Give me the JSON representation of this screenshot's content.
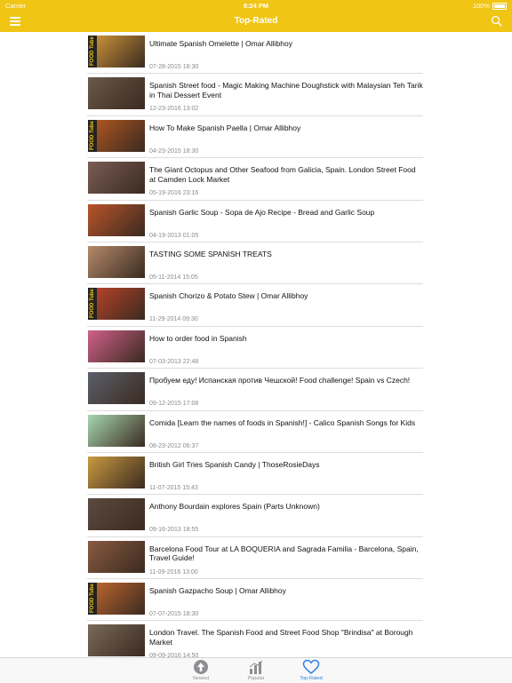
{
  "status": {
    "carrier": "Carrier",
    "time": "8:24 PM",
    "battery": "100%"
  },
  "nav": {
    "title": "Top-Rated"
  },
  "videos": [
    {
      "title": "Ultimate Spanish Omelette | Omar Allibhoy",
      "date": "07-28-2015 18:30",
      "thumb": "#d79a3a",
      "strip": "FOOD Tube"
    },
    {
      "title": "Spanish Street food - Magic Making Machine Doughstick with Malaysian Teh Tarik in Thai Dessert Event",
      "date": "12-23-2016 13:02",
      "thumb": "#6a5a4a",
      "strip": ""
    },
    {
      "title": "How To Make Spanish Paella | Omar Allibhoy",
      "date": "04-23-2015 18:30",
      "thumb": "#b85a20",
      "strip": "FOOD Tube"
    },
    {
      "title": "The Giant Octopus and Other Seafood from Galicia, Spain. London Street Food at Camden Lock Market",
      "date": "05-19-2016 23:16",
      "thumb": "#7a5d55",
      "strip": ""
    },
    {
      "title": "Spanish Garlic Soup - Sopa de Ajo Recipe - Bread and Garlic Soup",
      "date": "04-19-2013 01:05",
      "thumb": "#b9542a",
      "strip": ""
    },
    {
      "title": "TASTING SOME SPANISH TREATS",
      "date": "05-11-2014 15:05",
      "thumb": "#b48a6a",
      "strip": ""
    },
    {
      "title": "Spanish Chorizo & Potato Stew | Omar Allibhoy",
      "date": "11-29-2014 09:30",
      "thumb": "#c0452a",
      "strip": "FOOD Tube"
    },
    {
      "title": "How to order food in Spanish",
      "date": "07-03-2013 22:48",
      "thumb": "#d0608a",
      "strip": ""
    },
    {
      "title": "Пробуем еду! Испанская против Чешской! Food challenge! Spain vs Czech!",
      "date": "09-12-2015 17:08",
      "thumb": "#5a5f6a",
      "strip": ""
    },
    {
      "title": "Comida [Learn the names of foods in Spanish!] - Calico Spanish Songs for Kids",
      "date": "08-23-2012 06:37",
      "thumb": "#a6d6b0",
      "strip": ""
    },
    {
      "title": "British Girl Tries Spanish Candy | ThoseRosieDays",
      "date": "11-07-2015 15:43",
      "thumb": "#c99a40",
      "strip": ""
    },
    {
      "title": "Anthony Bourdain explores Spain (Parts Unknown)",
      "date": "09-16-2013 18:55",
      "thumb": "#5a4a40",
      "strip": ""
    },
    {
      "title": "Barcelona Food Tour at LA BOQUERIA and Sagrada Familia - Barcelona, Spain, Travel Guide!",
      "date": "11-09-2016 13:00",
      "thumb": "#8a5a40",
      "strip": ""
    },
    {
      "title": "Spanish Gazpacho Soup | Omar Allibhoy",
      "date": "07-07-2015 18:30",
      "thumb": "#c86a30",
      "strip": "FOOD Tube"
    },
    {
      "title": "London Travel. The Spanish Food and Street Food Shop \"Brindisa\" at Borough Market",
      "date": "09-09-2016 14:50",
      "thumb": "#7a6a5a",
      "strip": ""
    }
  ],
  "tabs": [
    {
      "label": "Newest",
      "icon": "arrow-up-circle-icon",
      "active": false
    },
    {
      "label": "Popular",
      "icon": "bar-chart-icon",
      "active": false
    },
    {
      "label": "Top-Rated",
      "icon": "heart-icon",
      "active": true
    }
  ],
  "colors": {
    "accent": "#f0c514",
    "tab_active": "#2f7fe6",
    "tab_inactive": "#8e8e93"
  }
}
